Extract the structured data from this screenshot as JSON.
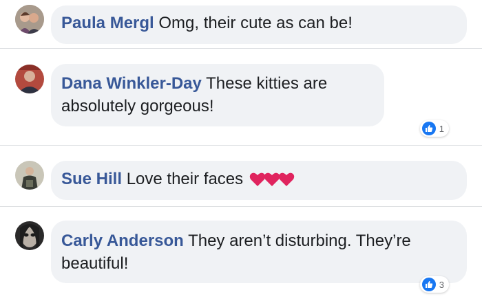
{
  "comments": [
    {
      "author": "Paula Mergl",
      "text": "Omg, their cute as can be!",
      "reactions": null
    },
    {
      "author": "Dana Winkler-Day",
      "text": "These kitties are absolutely gorgeous!",
      "reactions": "1"
    },
    {
      "author": "Sue Hill",
      "text": "Love their faces",
      "emoji": "heart-icon x3",
      "reactions": null
    },
    {
      "author": "Carly Anderson",
      "text": "They aren’t disturbing. They’re beautiful!",
      "reactions": "3"
    }
  ],
  "colors": {
    "author": "#385898",
    "bubble": "#f0f2f5",
    "like": "#1877f2",
    "heart": "#e0245e"
  }
}
